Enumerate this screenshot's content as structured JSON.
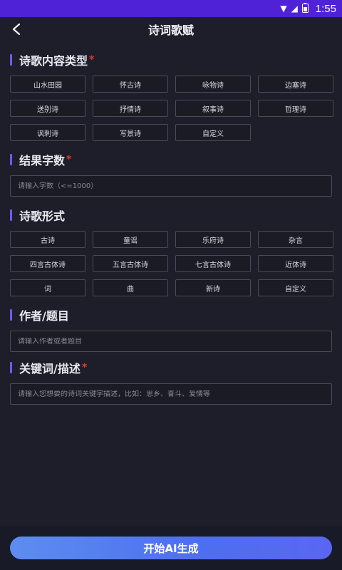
{
  "status_bar": {
    "time": "1:55"
  },
  "header": {
    "title": "诗词歌赋"
  },
  "sections": {
    "type": {
      "title": "诗歌内容类型",
      "required_mark": "*",
      "chips": [
        "山水田园",
        "怀古诗",
        "咏物诗",
        "边塞诗",
        "送别诗",
        "抒情诗",
        "叙事诗",
        "哲理诗",
        "讽刺诗",
        "写景诗",
        "自定义"
      ]
    },
    "word_count": {
      "title": "结果字数",
      "required_mark": "*",
      "placeholder": "请输入字数（<=1000）"
    },
    "form": {
      "title": "诗歌形式",
      "chips": [
        "古诗",
        "童谣",
        "乐府诗",
        "杂言",
        "四言古体诗",
        "五言古体诗",
        "七言古体诗",
        "近体诗",
        "词",
        "曲",
        "新诗",
        "自定义"
      ]
    },
    "author": {
      "title": "作者/题目",
      "placeholder": "请输入作者或者题目"
    },
    "keywords": {
      "title": "关键词/描述",
      "required_mark": "*",
      "placeholder": "请输入您想要的诗词关键字描述，比如：思乡、奋斗、爱情等"
    }
  },
  "footer": {
    "generate_label": "开始AI生成"
  },
  "colors": {
    "status_bar": "#4f22d8",
    "accent_bar": "#6a5cff",
    "required": "#e0382f",
    "button_start": "#5d8df0",
    "button_end": "#5a66f2"
  }
}
